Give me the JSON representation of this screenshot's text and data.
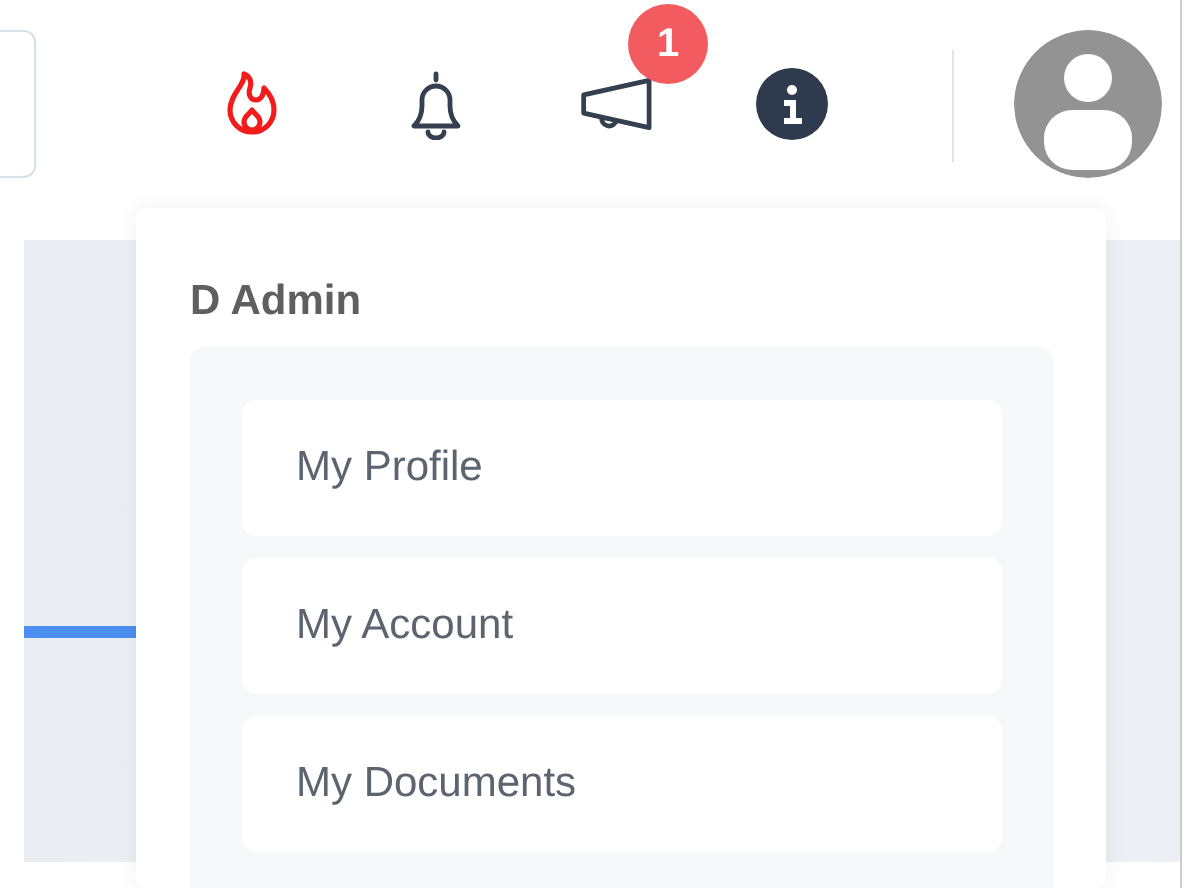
{
  "header": {
    "icons": [
      {
        "kind": "flame"
      },
      {
        "kind": "bell"
      },
      {
        "kind": "megaphone",
        "badge": "1"
      },
      {
        "kind": "info"
      }
    ]
  },
  "user_menu": {
    "title": "D Admin",
    "items": [
      {
        "label": "My Profile"
      },
      {
        "label": "My Account"
      },
      {
        "label": "My Documents"
      }
    ]
  }
}
